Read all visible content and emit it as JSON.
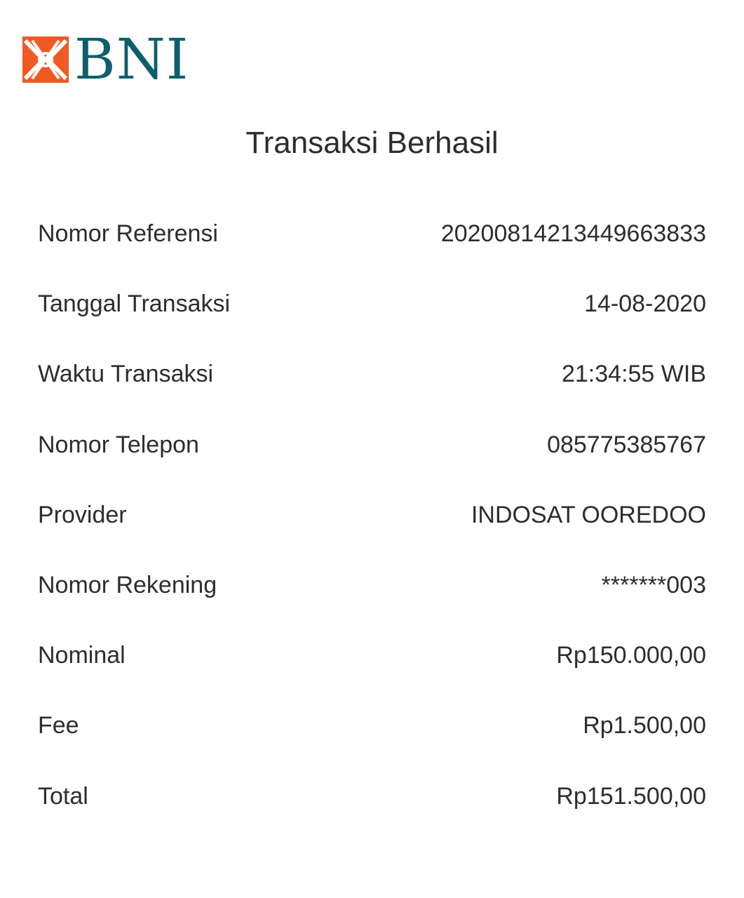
{
  "brand": {
    "name": "BNI",
    "color_primary": "#0e5f6c",
    "color_accent": "#f05a22",
    "logo_icon": "bni-logo-icon"
  },
  "header": {
    "title": "Transaksi Berhasil"
  },
  "details": [
    {
      "label": "Nomor Referensi",
      "value": "20200814213449663833"
    },
    {
      "label": "Tanggal Transaksi",
      "value": "14-08-2020"
    },
    {
      "label": "Waktu Transaksi",
      "value": "21:34:55 WIB"
    },
    {
      "label": "Nomor Telepon",
      "value": "085775385767"
    },
    {
      "label": "Provider",
      "value": "INDOSAT OOREDOO"
    },
    {
      "label": "Nomor Rekening",
      "value": "*******003"
    },
    {
      "label": "Nominal",
      "value": "Rp150.000,00"
    },
    {
      "label": "Fee",
      "value": "Rp1.500,00"
    },
    {
      "label": "Total",
      "value": "Rp151.500,00"
    }
  ]
}
